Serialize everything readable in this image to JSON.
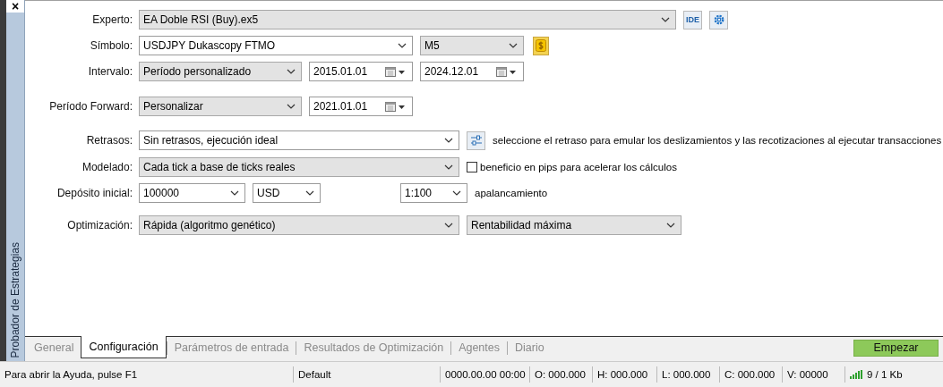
{
  "sidebar": {
    "close": "×",
    "title": "Probador de Estrategias"
  },
  "rows": [
    {
      "label": "Experto:",
      "controls": [
        {
          "kind": "select",
          "value": "EA Doble RSI (Buy).ex5"
        },
        {
          "kind": "button",
          "label": "IDE"
        },
        {
          "kind": "gear"
        }
      ]
    },
    {
      "label": "Símbolo:",
      "controls": [
        {
          "kind": "combo",
          "value": "USDJPY Dukascopy FTMO"
        },
        {
          "kind": "select",
          "value": "M5"
        },
        {
          "kind": "dollar"
        }
      ]
    },
    {
      "label": "Intervalo:",
      "controls": [
        {
          "kind": "select",
          "value": "Período personalizado"
        },
        {
          "kind": "date",
          "value": "2015.01.01"
        },
        {
          "kind": "date",
          "value": "2024.12.01"
        }
      ]
    },
    {
      "label": "Período Forward:",
      "controls": [
        {
          "kind": "select",
          "value": "Personalizar"
        },
        {
          "kind": "date",
          "value": "2021.01.01"
        }
      ]
    },
    {
      "label": "Retrasos:",
      "controls": [
        {
          "kind": "combo",
          "value": "Sin retrasos, ejecución ideal"
        },
        {
          "kind": "sliders"
        },
        {
          "kind": "note",
          "text": "seleccione el retraso para emular los deslizamientos y las recotizaciones al ejecutar transacciones"
        }
      ]
    },
    {
      "label": "Modelado:",
      "controls": [
        {
          "kind": "select",
          "value": "Cada tick a base de ticks reales"
        },
        {
          "kind": "checkbox",
          "checked": false,
          "text": "beneficio en pips para acelerar los cálculos"
        }
      ]
    },
    {
      "label": "Depósito inicial:",
      "controls": [
        {
          "kind": "combo",
          "value": "100000"
        },
        {
          "kind": "combo",
          "value": "USD"
        },
        {
          "kind": "combo",
          "value": "1:100"
        },
        {
          "kind": "note",
          "text": "apalancamiento"
        }
      ]
    },
    {
      "label": "Optimización:",
      "controls": [
        {
          "kind": "select",
          "value": "Rápida (algoritmo genético)"
        },
        {
          "kind": "select",
          "value": "Rentabilidad máxima"
        }
      ]
    }
  ],
  "tabs": [
    {
      "label": "General",
      "selected": false
    },
    {
      "label": "Configuración",
      "selected": true
    },
    {
      "label": "Parámetros de entrada",
      "selected": false
    },
    {
      "label": "Resultados de Optimización",
      "selected": false
    },
    {
      "label": "Agentes",
      "selected": false
    },
    {
      "label": "Diario",
      "selected": false
    }
  ],
  "start_button": "Empezar",
  "status_bar": [
    "Para abrir la Ayuda, pulse F1",
    "Default",
    "0000.00.00 00:00",
    "O: 000.000",
    "H: 000.000",
    "L: 000.000",
    "C: 000.000",
    "V: 00000"
  ],
  "connection": "9 / 1 Kb"
}
